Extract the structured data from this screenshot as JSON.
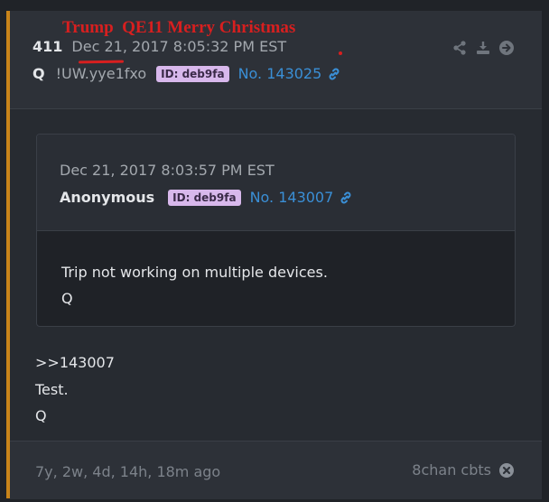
{
  "post": {
    "annotation": "Trump  QE11 Merry Christmas",
    "number": "411",
    "datetime": "Dec 21, 2017 8:05:32 PM EST",
    "author": "Q",
    "tripcode": "!UW.yye1fxo",
    "id_label": "ID: deb9fa",
    "post_link": "No. 143025",
    "icons": [
      "share-icon",
      "download-icon",
      "arrow-right-circle-icon",
      "link-icon"
    ]
  },
  "quoted": {
    "datetime": "Dec 21, 2017 8:03:57 PM EST",
    "author": "Anonymous",
    "id_label": "ID: deb9fa",
    "post_link": "No. 143007",
    "body": [
      "Trip not working on multiple devices.",
      "Q"
    ]
  },
  "body": [
    ">>143007",
    "Test.",
    "Q"
  ],
  "footer": {
    "age": "7y, 2w, 4d, 14h, 18m ago",
    "board": "8chan cbts",
    "icon": "close-circle-icon"
  },
  "colors": {
    "accent_border": "#c8841a",
    "link": "#3a8fd6",
    "id_badge": "#d8b8ec",
    "annotation": "#d81f1f"
  }
}
